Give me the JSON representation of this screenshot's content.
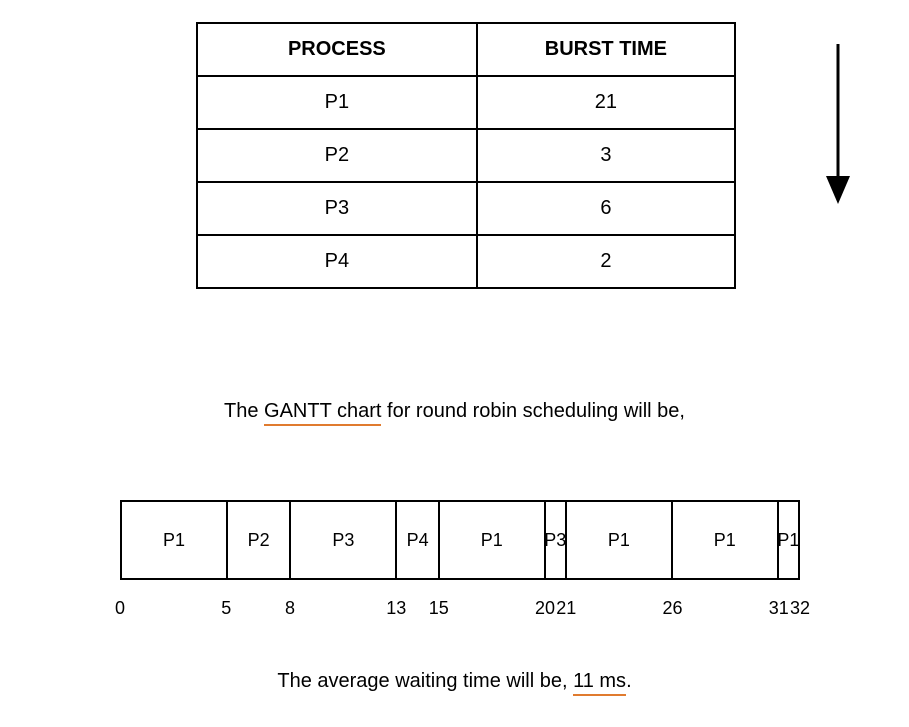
{
  "table": {
    "headers": {
      "process": "PROCESS",
      "burst": "BURST TIME"
    },
    "rows": [
      {
        "process": "P1",
        "burst": "21"
      },
      {
        "process": "P2",
        "burst": "3"
      },
      {
        "process": "P3",
        "burst": "6"
      },
      {
        "process": "P4",
        "burst": "2"
      }
    ]
  },
  "caption1": {
    "prefix": "The ",
    "underlined": "GANTT chart",
    "suffix": " for round robin scheduling will be,"
  },
  "gantt": {
    "segments": [
      {
        "label": "P1",
        "start": 0,
        "end": 5
      },
      {
        "label": "P2",
        "start": 5,
        "end": 8
      },
      {
        "label": "P3",
        "start": 8,
        "end": 13
      },
      {
        "label": "P4",
        "start": 13,
        "end": 15
      },
      {
        "label": "P1",
        "start": 15,
        "end": 20
      },
      {
        "label": "P3",
        "start": 20,
        "end": 21
      },
      {
        "label": "P1",
        "start": 21,
        "end": 26
      },
      {
        "label": "P1",
        "start": 26,
        "end": 31
      },
      {
        "label": "P1",
        "start": 31,
        "end": 32
      }
    ],
    "ticks": [
      0,
      5,
      8,
      13,
      15,
      20,
      21,
      26,
      31,
      32
    ],
    "total": 32
  },
  "caption2": {
    "prefix": "The average waiting time will be, ",
    "underlined": "11 ms",
    "suffix": "."
  },
  "chart_data": {
    "type": "table",
    "title": "Round Robin scheduling Gantt chart",
    "segments": [
      {
        "process": "P1",
        "start": 0,
        "end": 5
      },
      {
        "process": "P2",
        "start": 5,
        "end": 8
      },
      {
        "process": "P3",
        "start": 8,
        "end": 13
      },
      {
        "process": "P4",
        "start": 13,
        "end": 15
      },
      {
        "process": "P1",
        "start": 15,
        "end": 20
      },
      {
        "process": "P3",
        "start": 20,
        "end": 21
      },
      {
        "process": "P1",
        "start": 21,
        "end": 26
      },
      {
        "process": "P1",
        "start": 26,
        "end": 31
      },
      {
        "process": "P1",
        "start": 31,
        "end": 32
      }
    ],
    "time_axis_ticks": [
      0,
      5,
      8,
      13,
      15,
      20,
      21,
      26,
      31,
      32
    ],
    "average_waiting_time_ms": 11
  }
}
